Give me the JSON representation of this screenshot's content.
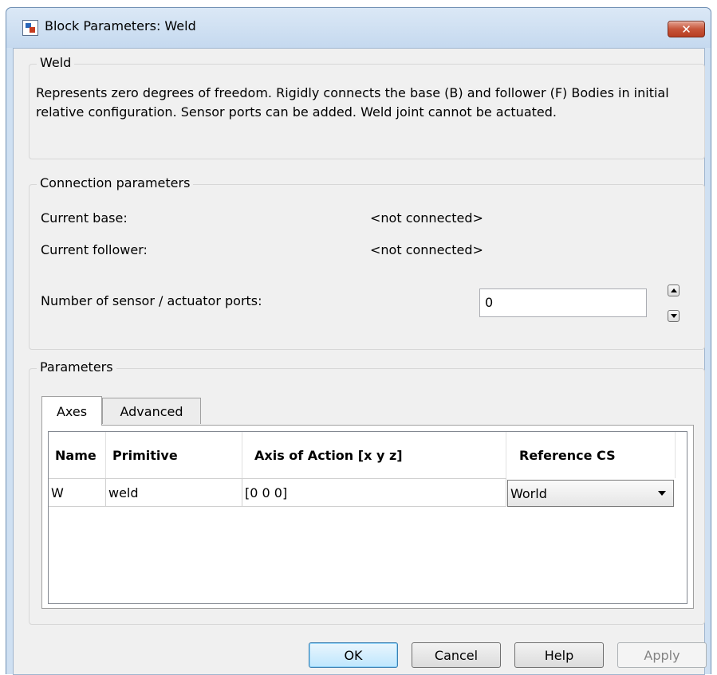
{
  "window": {
    "title": "Block Parameters: Weld",
    "close_label": "✕"
  },
  "weld_group": {
    "label": "Weld",
    "description": "Represents zero degrees of freedom. Rigidly connects the base (B) and follower (F) Bodies in initial relative configuration. Sensor ports can be added. Weld joint cannot be actuated."
  },
  "connection": {
    "label": "Connection parameters",
    "base_label": "Current base:",
    "base_value": "<not connected>",
    "follower_label": "Current follower:",
    "follower_value": "<not connected>",
    "ports_label": "Number of sensor / actuator ports:",
    "ports_value": "0"
  },
  "parameters": {
    "label": "Parameters",
    "tabs": [
      {
        "label": "Axes",
        "active": true
      },
      {
        "label": "Advanced",
        "active": false
      }
    ],
    "table": {
      "columns": [
        "Name",
        "Primitive",
        "Axis of Action [x y z]",
        "Reference CS"
      ],
      "rows": [
        [
          "W",
          "weld",
          "[0 0 0]",
          "World"
        ]
      ]
    }
  },
  "buttons": {
    "ok": "OK",
    "cancel": "Cancel",
    "help": "Help",
    "apply": "Apply"
  },
  "colors": {
    "title_bar": "#c5d9ef",
    "close_button": "#c7553a",
    "default_button": "#bee6fd",
    "dialog_background": "#f0f0f0"
  }
}
